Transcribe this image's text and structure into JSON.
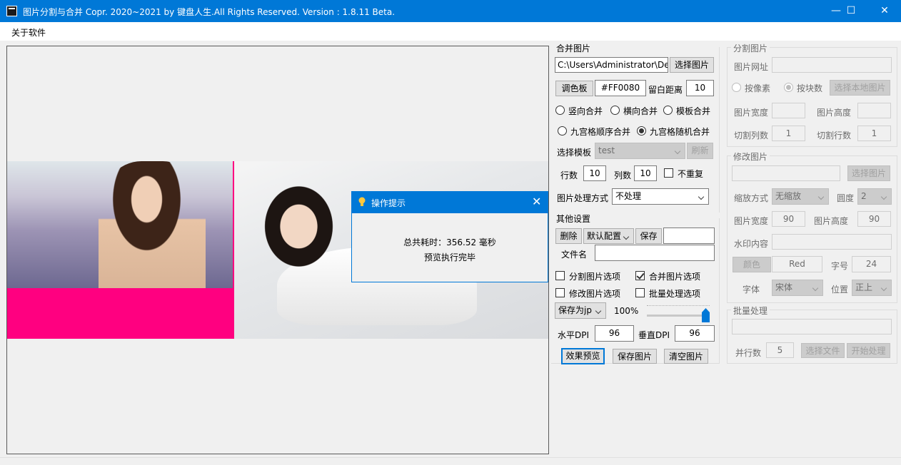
{
  "window": {
    "title": "图片分割与合并    Copr. 2020~2021 by 键盘人生.All Rights Reserved.  Version : 1.8.11 Beta.",
    "minimize": "—",
    "maximize": "☐",
    "close": "✕"
  },
  "menu": {
    "about": "关于软件"
  },
  "dialog": {
    "title": "操作提示",
    "close": "✕",
    "line1": "总共耗时：356.52 毫秒",
    "line2": "预览执行完毕"
  },
  "merge": {
    "title": "合并图片",
    "path_value": "C:\\Users\\Administrator\\De",
    "select_image": "选择图片",
    "palette": "调色板",
    "color_value": "#FF0080",
    "margin_label": "留白距离",
    "margin_value": "10",
    "radio_vertical": "竖向合并",
    "radio_horizontal": "横向合并",
    "radio_template": "模板合并",
    "radio_grid_seq": "九宫格顺序合并",
    "radio_grid_random": "九宫格随机合并",
    "template_label": "选择模板",
    "template_value": "test",
    "refresh": "刷新",
    "rows_label": "行数",
    "rows_value": "10",
    "cols_label": "列数",
    "cols_value": "10",
    "no_repeat": "不重复",
    "process_label": "图片处理方式",
    "process_value": "不处理"
  },
  "other": {
    "title": "其他设置",
    "delete": "删除",
    "config_value": "默认配置",
    "save": "保存",
    "config_name_value": "",
    "filename_label": "文件名",
    "filename_value": "",
    "opt_split": "分割图片选项",
    "opt_merge": "合并图片选项",
    "opt_modify": "修改图片选项",
    "opt_batch": "批量处理选项",
    "save_as": "保存为jp",
    "quality": "100%",
    "quality_fraction": 1.0,
    "hdpi_label": "水平DPI",
    "hdpi_value": "96",
    "vdpi_label": "垂直DPI",
    "vdpi_value": "96"
  },
  "actions": {
    "preview": "效果预览",
    "save_image": "保存图片",
    "clear_image": "清空图片"
  },
  "split": {
    "title": "分割图片",
    "url_label": "图片网址",
    "url_value": "",
    "by_pixel": "按像素",
    "by_block": "按块数",
    "select_local": "选择本地图片",
    "width_label": "图片宽度",
    "width_value": "",
    "height_label": "图片高度",
    "height_value": "",
    "cols_label": "切割列数",
    "cols_value": "1",
    "rows_label": "切割行数",
    "rows_value": "1"
  },
  "modify": {
    "title": "修改图片",
    "path_value": "",
    "select_image": "选择图片",
    "scale_label": "缩放方式",
    "scale_value": "无缩放",
    "round_label": "圆度",
    "round_value": "2",
    "width_label": "图片宽度",
    "width_value": "90",
    "height_label": "图片高度",
    "height_value": "90",
    "watermark_label": "水印内容",
    "watermark_value": "",
    "color_button": "颜色",
    "color_value": "Red",
    "fontsize_label": "字号",
    "fontsize_value": "24",
    "font_label": "字体",
    "font_value": "宋体",
    "position_label": "位置",
    "position_value": "正上"
  },
  "batch": {
    "title": "批量处理",
    "path_value": "",
    "threads_label": "并行数",
    "threads_value": "5",
    "select_file": "选择文件",
    "start": "开始处理"
  },
  "colors": {
    "accent": "#0078d7",
    "fill_color": "#ff0080"
  }
}
